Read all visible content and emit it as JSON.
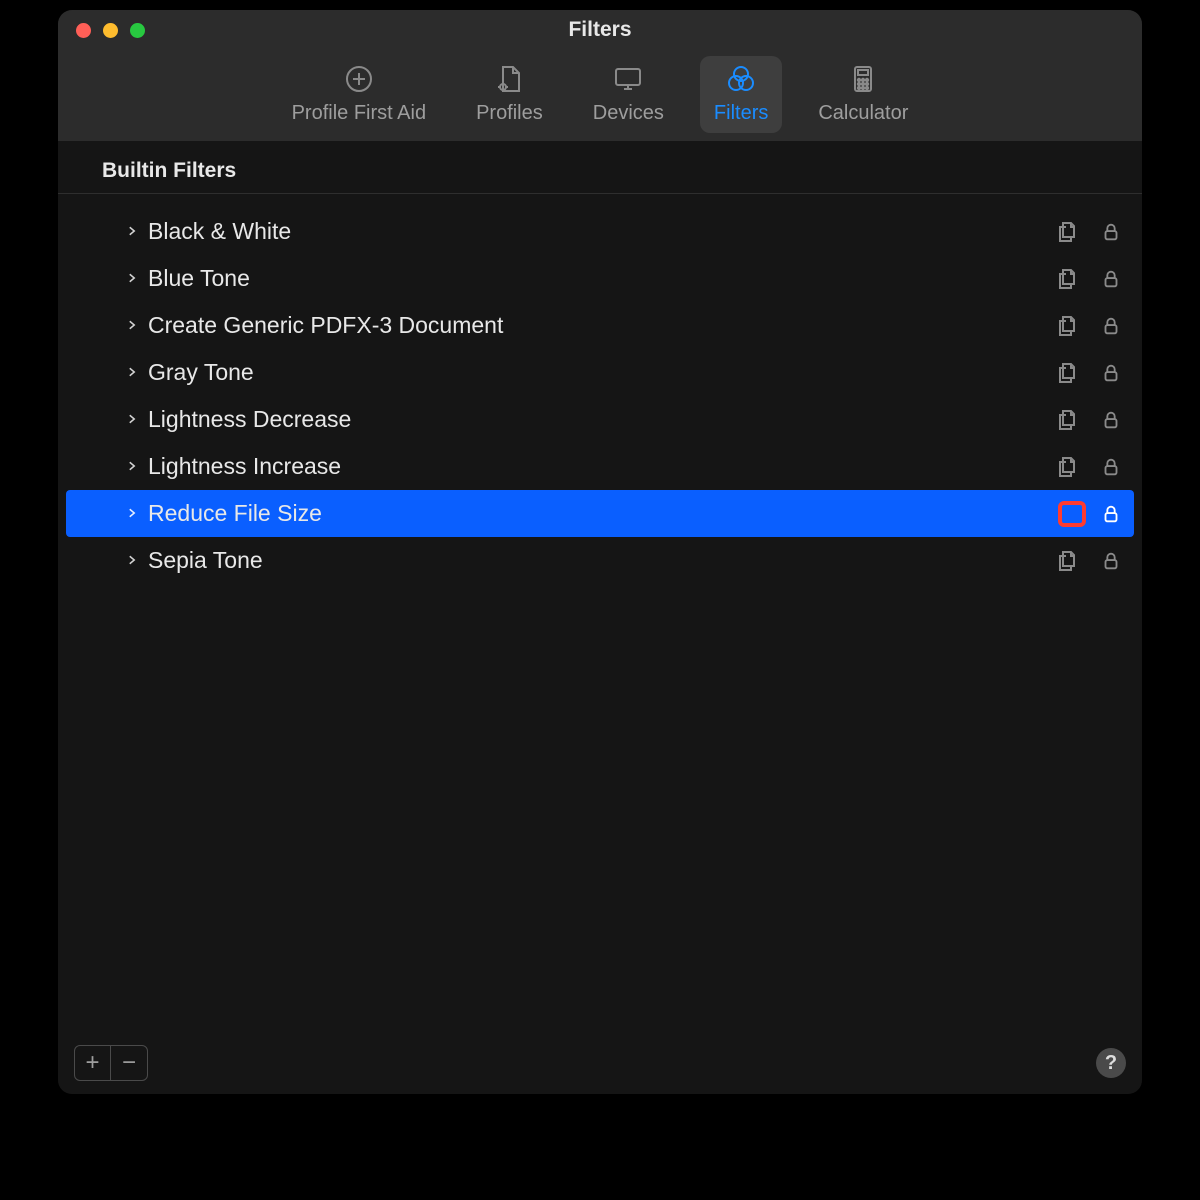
{
  "window": {
    "title": "Filters"
  },
  "tabs": [
    {
      "id": "profile-first-aid",
      "label": "Profile First Aid",
      "icon": "plus-circle-icon",
      "active": false
    },
    {
      "id": "profiles",
      "label": "Profiles",
      "icon": "document-gear-icon",
      "active": false
    },
    {
      "id": "devices",
      "label": "Devices",
      "icon": "monitor-icon",
      "active": false
    },
    {
      "id": "filters",
      "label": "Filters",
      "icon": "filters-icon",
      "active": true
    },
    {
      "id": "calculator",
      "label": "Calculator",
      "icon": "calculator-icon",
      "active": false
    }
  ],
  "section": {
    "header": "Builtin Filters"
  },
  "filters": [
    {
      "name": "Black & White",
      "selected": false,
      "duplicate_highlighted": false
    },
    {
      "name": "Blue Tone",
      "selected": false,
      "duplicate_highlighted": false
    },
    {
      "name": "Create Generic PDFX-3 Document",
      "selected": false,
      "duplicate_highlighted": false
    },
    {
      "name": "Gray Tone",
      "selected": false,
      "duplicate_highlighted": false
    },
    {
      "name": "Lightness Decrease",
      "selected": false,
      "duplicate_highlighted": false
    },
    {
      "name": "Lightness Increase",
      "selected": false,
      "duplicate_highlighted": false
    },
    {
      "name": "Reduce File Size",
      "selected": true,
      "duplicate_highlighted": true
    },
    {
      "name": "Sepia Tone",
      "selected": false,
      "duplicate_highlighted": false
    }
  ],
  "footer": {
    "add_label": "+",
    "remove_label": "−",
    "help_label": "?"
  }
}
